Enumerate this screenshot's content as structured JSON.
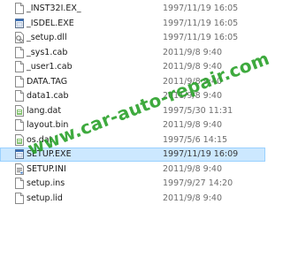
{
  "files": [
    {
      "name": "_INST32I.EX_",
      "date": "1997/11/19 16:05",
      "icon": "generic-file-icon"
    },
    {
      "name": "_ISDEL.EXE",
      "date": "1997/11/19 16:05",
      "icon": "exe-icon"
    },
    {
      "name": "_setup.dll",
      "date": "1997/11/19 16:05",
      "icon": "dll-icon"
    },
    {
      "name": "_sys1.cab",
      "date": "2011/9/8 9:40",
      "icon": "generic-file-icon"
    },
    {
      "name": "_user1.cab",
      "date": "2011/9/8 9:40",
      "icon": "generic-file-icon"
    },
    {
      "name": "DATA.TAG",
      "date": "2011/9/8 9:40",
      "icon": "generic-file-icon"
    },
    {
      "name": "data1.cab",
      "date": "2011/9/8 9:40",
      "icon": "generic-file-icon"
    },
    {
      "name": "lang.dat",
      "date": "1997/5/30 11:31",
      "icon": "data-file-icon"
    },
    {
      "name": "layout.bin",
      "date": "2011/9/8 9:40",
      "icon": "generic-file-icon"
    },
    {
      "name": "os.dat",
      "date": "1997/5/6 14:15",
      "icon": "data-file-icon"
    },
    {
      "name": "SETUP.EXE",
      "date": "1997/11/19 16:09",
      "icon": "exe-icon",
      "selected": true
    },
    {
      "name": "SETUP.INI",
      "date": "2011/9/8 9:40",
      "icon": "ini-icon"
    },
    {
      "name": "setup.ins",
      "date": "1997/9/27 14:20",
      "icon": "generic-file-icon"
    },
    {
      "name": "setup.lid",
      "date": "2011/9/8 9:40",
      "icon": "generic-file-icon"
    }
  ],
  "watermark": "www.car-auto-repair.com",
  "colors": {
    "selection_bg": "#cce8ff",
    "selection_border": "#99d1ff",
    "watermark": "#2aa12a",
    "date_text": "#6d6d6d"
  }
}
